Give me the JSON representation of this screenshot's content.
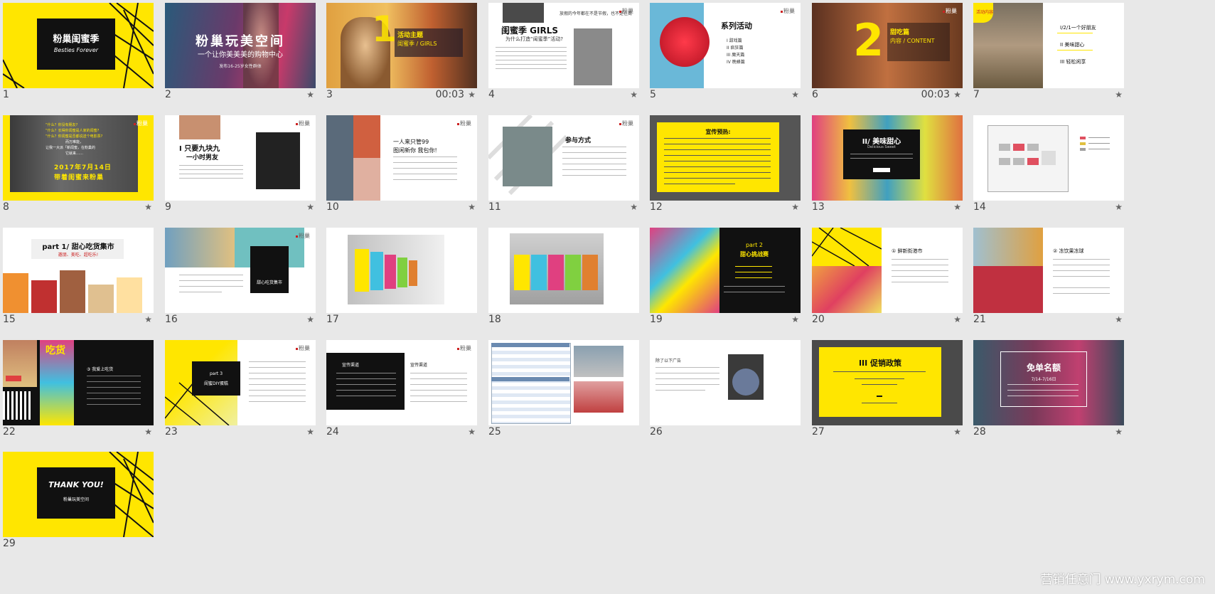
{
  "slides": [
    {
      "num": "1",
      "title": "粉巢闺蜜季",
      "subtitle": "Besties Forever"
    },
    {
      "num": "2",
      "title": "粉巢玩美空间",
      "subtitle": "一个让你美美美的购物中心",
      "caption": "发布16-25岁女性群体"
    },
    {
      "num": "3",
      "time": "00:03",
      "big": "1",
      "title": "活动主题",
      "subtitle": "闺蜜季 / GIRLS"
    },
    {
      "num": "4",
      "title": "闺蜜季 GIRLS",
      "subtitle": "为什么打造“闺蜜季”活动?",
      "caption": "放假的今年都在不是节假，也不是在周"
    },
    {
      "num": "5",
      "title": "系列活动",
      "items": [
        "I 甜戏篇",
        "II 疯狂篇",
        "III 魔天篇",
        "IV 晚蜂篇"
      ]
    },
    {
      "num": "6",
      "time": "00:03",
      "big": "2",
      "title": "甜吃篇",
      "subtitle": "内容 / CONTENT"
    },
    {
      "num": "7",
      "tag": "活动内容",
      "items": [
        "I/2/1一个好朋友",
        "II 美味甜心",
        "III 轻松闲享"
      ]
    },
    {
      "num": "8",
      "lines": [
        "“什么？你没有朋友?",
        "“什么？长得你闺蜜是人家的闺蜜?",
        "“什么？你闺蜜是否都说送个电影票?",
        "而万难能，",
        "让我一大派「新闺蜜，在粉巢的",
        "它就来……"
      ],
      "title": "2017年7月14日",
      "subtitle": "带着闺蜜来粉巢"
    },
    {
      "num": "9",
      "title": "I 只要九块九",
      "subtitle": "一小时男友"
    },
    {
      "num": "10",
      "title": "一人来只管99",
      "subtitle": "图闲新你 我包你!"
    },
    {
      "num": "11",
      "title": "参与方式"
    },
    {
      "num": "12",
      "title": "宣传预热:"
    },
    {
      "num": "13",
      "title": "II/ 美味甜心",
      "subtitle": "Delicious Sweet"
    },
    {
      "num": "14"
    },
    {
      "num": "15",
      "title": "part 1/ 甜心吃货集市",
      "subtitle": "邀朋、美吃、超吃乐!"
    },
    {
      "num": "16",
      "caption": "甜心吃货集市"
    },
    {
      "num": "17"
    },
    {
      "num": "18"
    },
    {
      "num": "19",
      "title": "part 2",
      "subtitle": "甜心挑战赛"
    },
    {
      "num": "20",
      "title": "① 鲜新街港市"
    },
    {
      "num": "21",
      "title": "② 冻饮果冻球"
    },
    {
      "num": "22",
      "title": "吃货",
      "subtitle": "③ 我爱上吃货"
    },
    {
      "num": "23",
      "title": "part 3",
      "subtitle": "闺蜜DIY蛋糕"
    },
    {
      "num": "24",
      "title": "宣传渠道",
      "subtitle": "宣传渠道"
    },
    {
      "num": "25"
    },
    {
      "num": "26",
      "title": "除了以下广告"
    },
    {
      "num": "27",
      "title": "III 促销政策"
    },
    {
      "num": "28",
      "title": "免单名额",
      "subtitle": "7/14-7/16日"
    },
    {
      "num": "29",
      "title": "THANK YOU!",
      "subtitle": "粉巢玩美空间"
    }
  ],
  "star_glyph": "★",
  "watermark": "营销任意门 www.yxrym.com",
  "colors": {
    "yellow": "#ffe600",
    "black": "#111111",
    "bg": "#e8e8e8"
  }
}
